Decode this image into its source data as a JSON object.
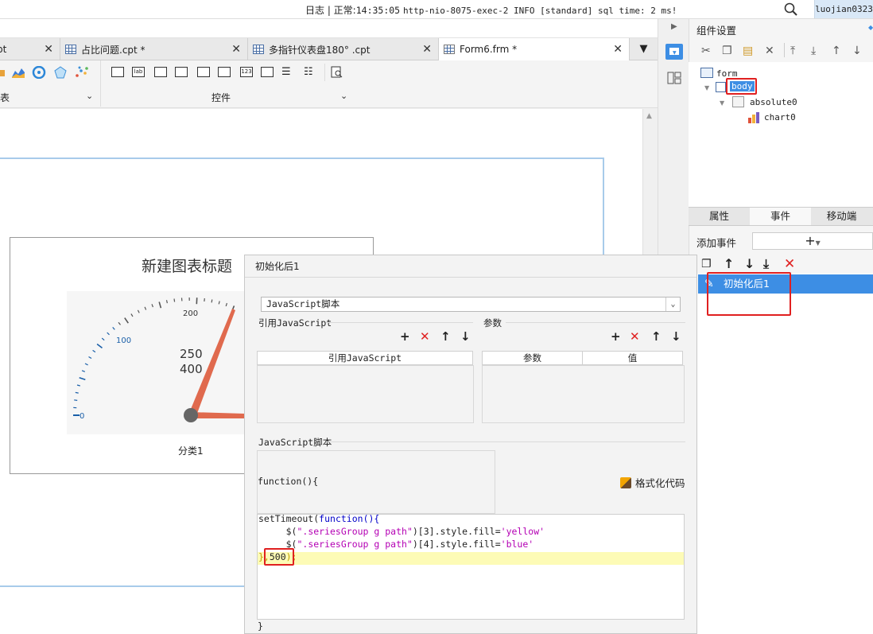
{
  "status": {
    "prefix": "日志 | 正常:",
    "time": "14:35:05",
    "message": "http-nio-8075-exec-2 INFO [standard] sql time: 2 ms!",
    "user": "luojian0323"
  },
  "tabs": [
    {
      "label": "pt",
      "closable": true
    },
    {
      "label": "占比问题.cpt *",
      "closable": true
    },
    {
      "label": "多指针仪表盘180° .cpt",
      "closable": true
    },
    {
      "label": "Form6.frm *",
      "closable": true
    }
  ],
  "toolbar": {
    "group_chart": "表",
    "group_widget": "控件"
  },
  "chart": {
    "title": "新建图表标题",
    "ticks": [
      "0",
      "100",
      "200"
    ],
    "value_1": "250",
    "value_2": "400",
    "category": "分类1"
  },
  "right_panel": {
    "title": "组件设置",
    "tree": [
      "form",
      "body",
      "absolute0",
      "chart0"
    ],
    "tabs": [
      "属性",
      "事件",
      "移动端"
    ],
    "add_event_label": "添加事件",
    "add_event_button": "+",
    "event_item": "初始化后1"
  },
  "dialog": {
    "title": "初始化后1",
    "type_value": "JavaScript脚本",
    "ref_js_label": "引用JavaScript",
    "params_label": "参数",
    "ref_js_column": "引用JavaScript",
    "param_column": "参数",
    "value_column": "值",
    "js_script_label": "JavaScript脚本",
    "func_open": "function(){",
    "format_button": "格式化代码",
    "func_close": "}",
    "code": {
      "l1_a": "setTimeout(",
      "l1_b": "function",
      "l1_c": "(){",
      "l2_a": "     $(",
      "l2_b": "\".seriesGroup g path\"",
      "l2_c": ")[3].style.fill=",
      "l2_d": "'yellow'",
      "l3_a": "     $(",
      "l3_b": "\".seriesGroup g path\"",
      "l3_c": ")[4].style.fill=",
      "l3_d": "'blue'",
      "l4_a": "},",
      "l4_b": "500",
      "l4_c": ");"
    }
  },
  "colors": {
    "selection": "#3d8ee4",
    "annotation": "#e02020",
    "needle": "#e06a4e",
    "frame": "#a8cbea"
  }
}
